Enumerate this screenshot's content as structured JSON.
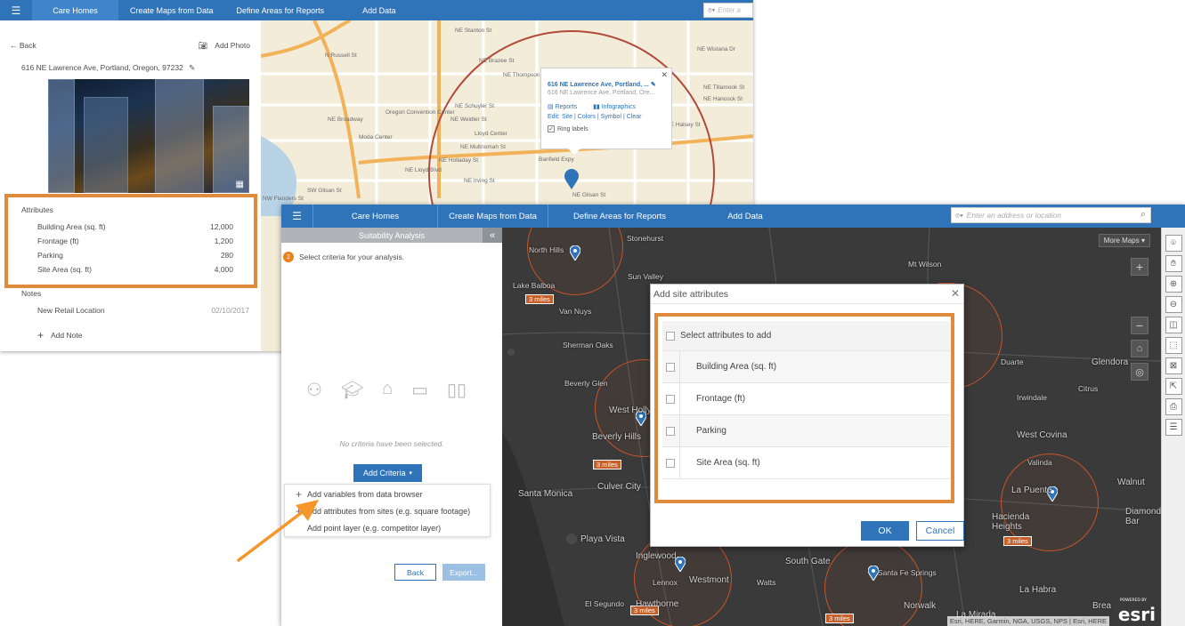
{
  "shotA": {
    "nav": [
      "Care Homes",
      "Create Maps from Data",
      "Define Areas for Reports",
      "Add Data"
    ],
    "search_placeholder": "Enter a",
    "back_label": "Back",
    "add_photo_label": "Add Photo",
    "address": "616 NE Lawrence Ave, Portland, Oregon, 97232",
    "attributes_title": "Attributes",
    "attributes": [
      {
        "name": "Building Area (sq. ft)",
        "value": "12,000"
      },
      {
        "name": "Frontage (ft)",
        "value": "1,200"
      },
      {
        "name": "Parking",
        "value": "280"
      },
      {
        "name": "Site Area (sq. ft)",
        "value": "4,000"
      }
    ],
    "notes_title": "Notes",
    "note": {
      "text": "New Retail Location",
      "date": "02/10/2017"
    },
    "add_note_label": "Add Note",
    "popup": {
      "title": "616 NE Lawrence Ave, Portland, ...",
      "subtitle": "616 NE Lawrence Ave, Portland, Ore...",
      "reports": "Reports",
      "infographics": "Infographics",
      "edit_line": "Edit: Site | Colors | Symbol | Clear",
      "ring_labels": "Ring labels"
    },
    "map_labels": [
      "NE Stanton St",
      "N Russell St",
      "NE Brazee St",
      "NE Thompson St",
      "NE Wistaria Dr",
      "NE Tillamook St",
      "NE Hancock St",
      "NE Schuyler St",
      "NE Weidler St",
      "NE Multnomah St",
      "NE Holladay St",
      "NE Irving St",
      "NE Glisan St",
      "SW Glisan St",
      "NE Halsey St",
      "Lloyd Center",
      "Moda Center",
      "Oregon Convention Center",
      "NE Broadway",
      "NW Flanders St",
      "NE Lloyd Blvd",
      "Banfield Expy"
    ]
  },
  "shotB": {
    "nav": [
      "Care Homes",
      "Create Maps from Data",
      "Define Areas for Reports",
      "Add Data"
    ],
    "search_placeholder": "Enter an address or location",
    "panel_title": "Suitability Analysis",
    "step_number": "2",
    "step_text": "Select criteria for your analysis.",
    "no_criteria": "No criteria have been selected.",
    "add_criteria_label": "Add Criteria",
    "criteria_menu": [
      "Add variables from data browser",
      "Add attributes from sites (e.g. square footage)",
      "Add point layer (e.g. competitor layer)"
    ],
    "back_label": "Back",
    "export_label": "Export...",
    "more_maps_label": "More Maps",
    "map_labels": [
      "Stonehurst",
      "North Hills",
      "Sun Valley",
      "Mt Wilson",
      "Lake Balboa",
      "Van Nuys",
      "Sherman Oaks",
      "Beverly Glen",
      "West Hollywood",
      "Beverly Hills",
      "Culver City",
      "Santa Monica",
      "Playa Vista",
      "Inglewood",
      "Lennox",
      "Westmont",
      "Watts",
      "South Gate",
      "Santa Fe Springs",
      "El Segundo",
      "Hawthorne",
      "Norwalk",
      "La Mirada",
      "La Habra",
      "Brea",
      "Duarte",
      "Glendora",
      "Irwindale",
      "Citrus",
      "West Covina",
      "Valinda",
      "La Puente",
      "Walnut",
      "Hacienda Heights",
      "Diamond Bar"
    ],
    "miles_label": "3 miles",
    "attribution": "Esri, HERE, Garmin, NGA, USGS, NPS | Esri, HERE",
    "esri_logo": "esri",
    "powered_by": "POWERED BY"
  },
  "dialog": {
    "title": "Add site attributes",
    "select_all_label": "Select attributes to add",
    "attributes": [
      "Building Area (sq. ft)",
      "Frontage (ft)",
      "Parking",
      "Site Area (sq. ft)"
    ],
    "ok_label": "OK",
    "cancel_label": "Cancel"
  },
  "colors": {
    "nav_blue": "#2f73b8",
    "highlight_orange": "#e08a3c",
    "arrow_orange": "#f5962a",
    "ring": "#c7542a"
  }
}
